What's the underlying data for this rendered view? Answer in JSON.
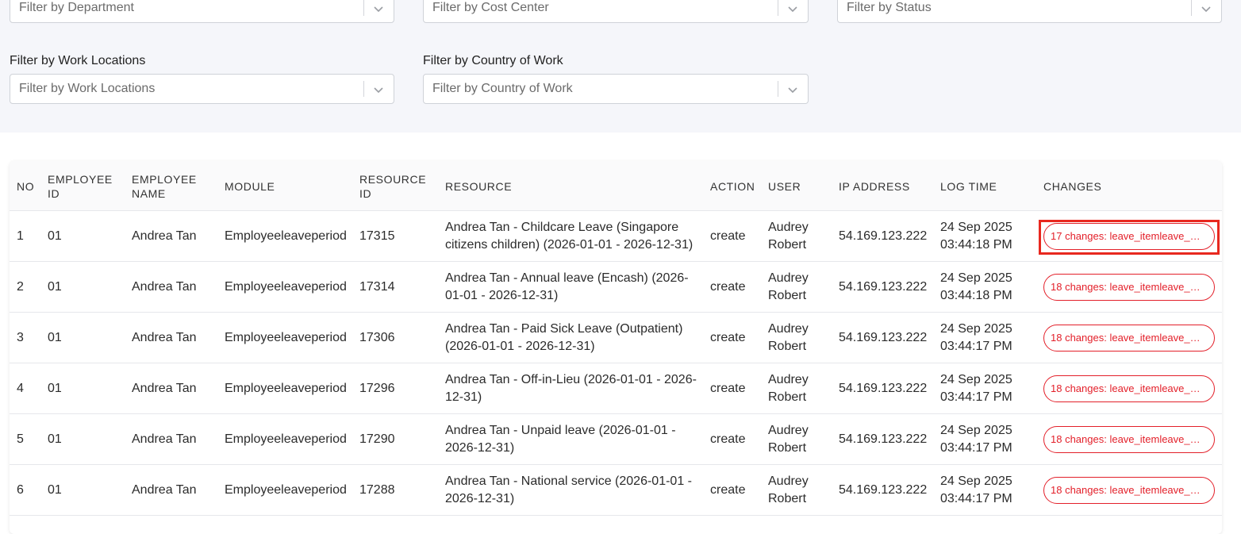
{
  "filters": {
    "department": {
      "placeholder": "Filter by Department"
    },
    "cost_center": {
      "placeholder": "Filter by Cost Center"
    },
    "status": {
      "placeholder": "Filter by Status"
    },
    "work_locations": {
      "label": "Filter by Work Locations",
      "placeholder": "Filter by Work Locations"
    },
    "country_of_work": {
      "label": "Filter by Country of Work",
      "placeholder": "Filter by Country of Work"
    }
  },
  "table": {
    "headers": {
      "no": "NO",
      "employee_id_1": "EMPLOYEE",
      "employee_id_2": "ID",
      "employee_name_1": "EMPLOYEE",
      "employee_name_2": "NAME",
      "module": "MODULE",
      "resource_id_1": "RESOURCE",
      "resource_id_2": "ID",
      "resource": "RESOURCE",
      "action": "ACTION",
      "user": "USER",
      "ip_address": "IP ADDRESS",
      "log_time": "LOG TIME",
      "changes": "CHANGES"
    },
    "rows": [
      {
        "no": "1",
        "employee_id": "01",
        "employee_name": "Andrea Tan",
        "module": "Employeeleaveperiod",
        "resource_id": "17315",
        "resource_1": "Andrea Tan - Childcare Leave (Singapore",
        "resource_2": "citizens children) (2026-01-01 - 2026-12-31)",
        "action": "create",
        "user_1": "Audrey",
        "user_2": "Robert",
        "ip": "54.169.123.222",
        "log_date": "24 Sep 2025",
        "log_time": "03:44:18 PM",
        "changes": "17 changes: leave_itemleave_…"
      },
      {
        "no": "2",
        "employee_id": "01",
        "employee_name": "Andrea Tan",
        "module": "Employeeleaveperiod",
        "resource_id": "17314",
        "resource_1": "Andrea Tan - Annual leave (Encash) (2026-",
        "resource_2": "01-01 - 2026-12-31)",
        "action": "create",
        "user_1": "Audrey",
        "user_2": "Robert",
        "ip": "54.169.123.222",
        "log_date": "24 Sep 2025",
        "log_time": "03:44:18 PM",
        "changes": "18 changes: leave_itemleave_…"
      },
      {
        "no": "3",
        "employee_id": "01",
        "employee_name": "Andrea Tan",
        "module": "Employeeleaveperiod",
        "resource_id": "17306",
        "resource_1": "Andrea Tan - Paid Sick Leave (Outpatient)",
        "resource_2": "(2026-01-01 - 2026-12-31)",
        "action": "create",
        "user_1": "Audrey",
        "user_2": "Robert",
        "ip": "54.169.123.222",
        "log_date": "24 Sep 2025",
        "log_time": "03:44:17 PM",
        "changes": "18 changes: leave_itemleave_…"
      },
      {
        "no": "4",
        "employee_id": "01",
        "employee_name": "Andrea Tan",
        "module": "Employeeleaveperiod",
        "resource_id": "17296",
        "resource_1": "Andrea Tan - Off-in-Lieu (2026-01-01 - 2026-",
        "resource_2": "12-31)",
        "action": "create",
        "user_1": "Audrey",
        "user_2": "Robert",
        "ip": "54.169.123.222",
        "log_date": "24 Sep 2025",
        "log_time": "03:44:17 PM",
        "changes": "18 changes: leave_itemleave_…"
      },
      {
        "no": "5",
        "employee_id": "01",
        "employee_name": "Andrea Tan",
        "module": "Employeeleaveperiod",
        "resource_id": "17290",
        "resource_1": "Andrea Tan - Unpaid leave (2026-01-01 -",
        "resource_2": "2026-12-31)",
        "action": "create",
        "user_1": "Audrey",
        "user_2": "Robert",
        "ip": "54.169.123.222",
        "log_date": "24 Sep 2025",
        "log_time": "03:44:17 PM",
        "changes": "18 changes: leave_itemleave_…"
      },
      {
        "no": "6",
        "employee_id": "01",
        "employee_name": "Andrea Tan",
        "module": "Employeeleaveperiod",
        "resource_id": "17288",
        "resource_1": "Andrea Tan - National service (2026-01-01 -",
        "resource_2": "2026-12-31)",
        "action": "create",
        "user_1": "Audrey",
        "user_2": "Robert",
        "ip": "54.169.123.222",
        "log_date": "24 Sep 2025",
        "log_time": "03:44:17 PM",
        "changes": "18 changes: leave_itemleave_…"
      }
    ]
  },
  "icons": {
    "select_arrow": "chevron-down-icon"
  },
  "colors": {
    "filter_background": "#f5f6fa",
    "changes_badge": "#e3202a",
    "highlight_box": "#e8281f"
  }
}
